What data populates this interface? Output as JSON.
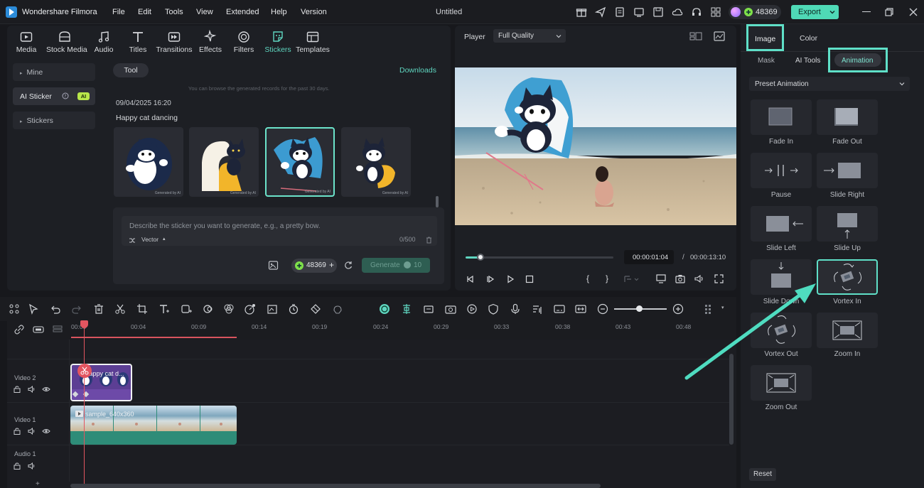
{
  "app": {
    "name": "Wondershare Filmora",
    "title": "Untitled",
    "credits": "48369",
    "export_label": "Export",
    "menu": [
      "File",
      "Edit",
      "Tools",
      "View",
      "Extended",
      "Help",
      "Version"
    ]
  },
  "media": {
    "categories": [
      "Media",
      "Stock Media",
      "Audio",
      "Titles",
      "Transitions",
      "Effects",
      "Filters",
      "Stickers",
      "Templates"
    ],
    "active_category": "Stickers",
    "sidebar": {
      "mine": "Mine",
      "ai_sticker": "AI Sticker",
      "ai_badge": "AI",
      "stickers": "Stickers"
    },
    "tool_tab": "Tool",
    "downloads": "Downloads",
    "notice": "You can browse the generated records for the past 30 days.",
    "record_date": "09/04/2025 16:20",
    "prompt_title": "Happy cat dancing",
    "thumb_caption": "Generated by AI",
    "prompt_placeholder": "Describe the sticker you want to generate, e.g., a pretty bow.",
    "style_label": "Vector",
    "char_count": "0/500",
    "credits": "48369",
    "generate_label": "Generate",
    "generate_cost": "10"
  },
  "player": {
    "label": "Player",
    "quality": "Full Quality",
    "current_time": "00:00:01:04",
    "separator": "/",
    "total_time": "00:00:13:10",
    "progress": 0.1
  },
  "inspector": {
    "tabs": [
      "Image",
      "Color"
    ],
    "subtabs": [
      "Mask",
      "AI Tools",
      "Animation"
    ],
    "preset_label": "Preset Animation",
    "animations": [
      "Fade In",
      "Fade Out",
      "Pause",
      "Slide Right",
      "Slide Left",
      "Slide Up",
      "Slide Down",
      "Vortex In",
      "Vortex Out",
      "Zoom In",
      "Zoom Out"
    ],
    "selected_animation": "Vortex In",
    "reset_label": "Reset",
    "highlight_color": "#5fe0c8"
  },
  "timeline": {
    "ticks": [
      "00:00",
      "00:04",
      "00:09",
      "00:14",
      "00:19",
      "00:24",
      "00:29",
      "00:33",
      "00:38",
      "00:43",
      "00:48"
    ],
    "tracks": [
      "Video 2",
      "Video 1",
      "Audio 1"
    ],
    "clip_sticker": "Happy cat d...",
    "clip_video": "sample_640x360"
  }
}
